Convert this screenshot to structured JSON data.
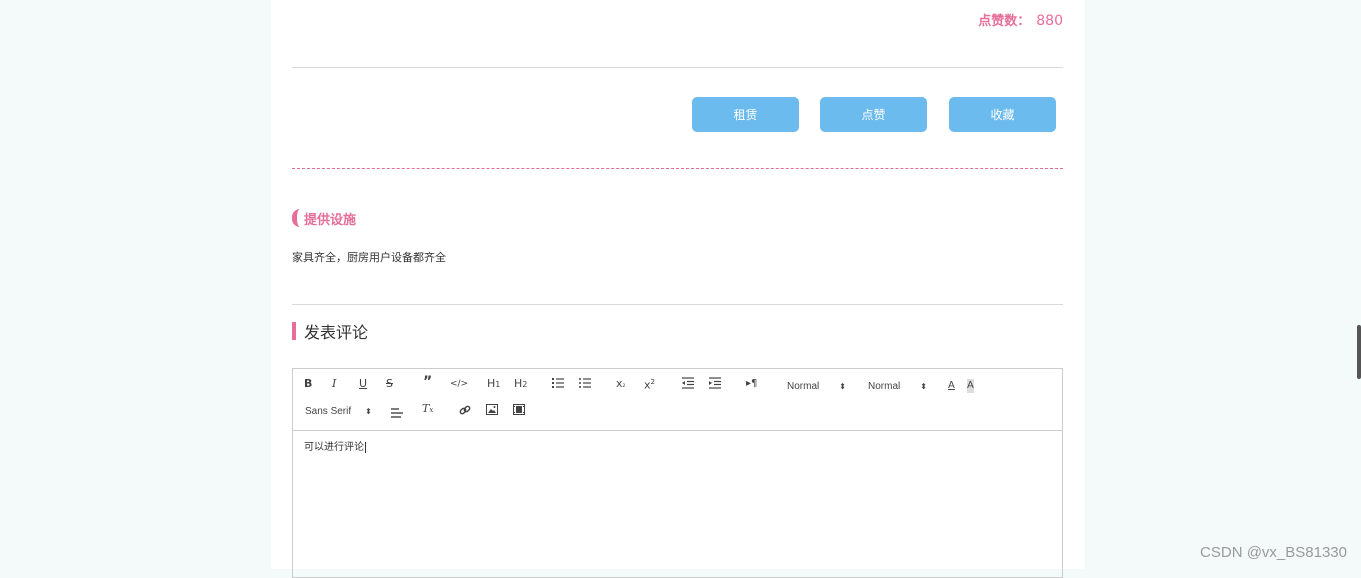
{
  "likes": {
    "label": "点赞数：",
    "value": "880"
  },
  "actions": {
    "rent": "租赁",
    "like": "点赞",
    "favorite": "收藏"
  },
  "facilities": {
    "title": "提供设施",
    "text": "家具齐全，厨房用户设备都齐全"
  },
  "comment": {
    "title": "发表评论",
    "editor": {
      "header_select": "Normal",
      "size_select": "Normal",
      "font_select": "Sans Serif",
      "content": "可以进行评论"
    }
  },
  "watermark": "CSDN @vx_BS81330",
  "colors": {
    "accent": "#e66f9a",
    "button": "#6cbbee"
  }
}
